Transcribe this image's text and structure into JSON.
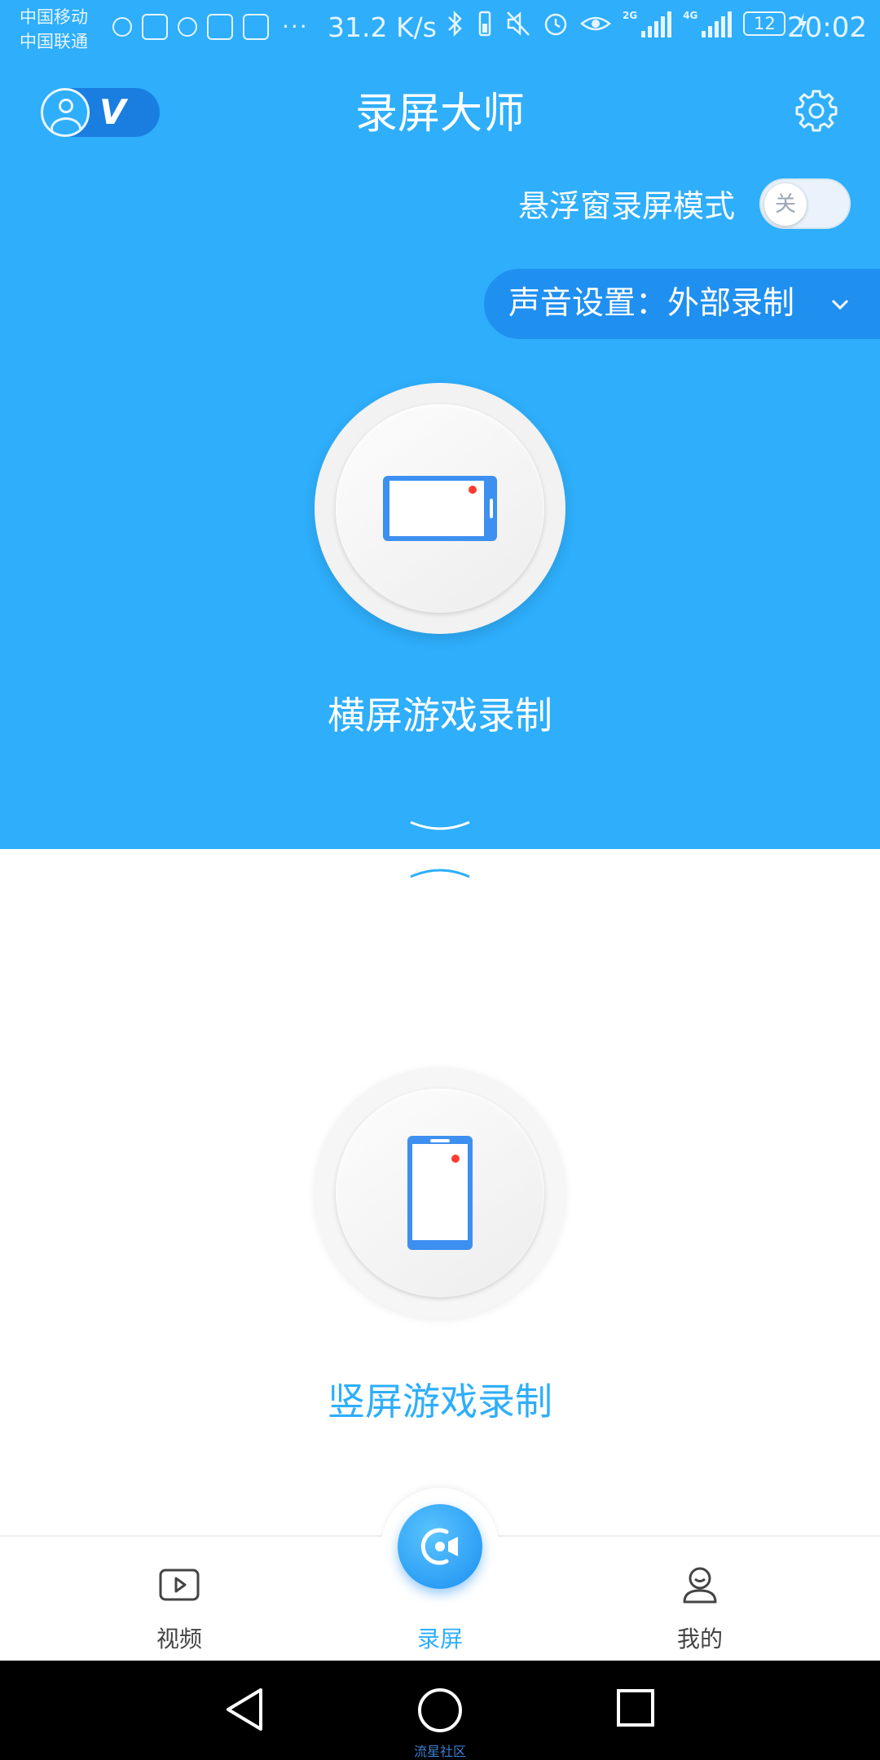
{
  "status_bar": {
    "carrier_1": "中国移动",
    "carrier_2": "中国联通",
    "net_speed": "31.2 K/s",
    "signal_1": "2G",
    "signal_2": "4G",
    "battery": "12",
    "time": "20:02",
    "more": "···"
  },
  "header": {
    "title": "录屏大师",
    "vip_badge": "V"
  },
  "float_mode": {
    "label": "悬浮窗录屏模式",
    "toggle_state": "关"
  },
  "sound_settings": {
    "label": "声音设置：外部录制"
  },
  "modes": {
    "landscape": "横屏游戏录制",
    "portrait": "竖屏游戏录制"
  },
  "bottom_nav": {
    "video": "视频",
    "record": "录屏",
    "mine": "我的"
  },
  "watermark": "流星社区",
  "colors": {
    "primary": "#2eaefb",
    "primary_dark": "#1f8ff0",
    "accent_red": "#ff3b30",
    "device_blue": "#3d8ff0"
  }
}
